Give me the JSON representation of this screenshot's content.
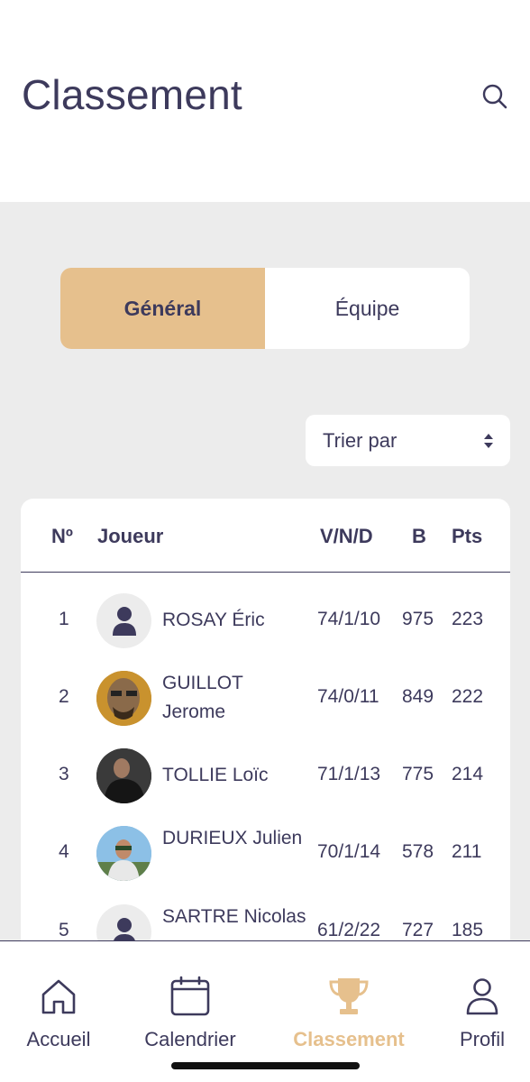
{
  "header": {
    "title": "Classement"
  },
  "segments": [
    {
      "label": "Général",
      "active": true
    },
    {
      "label": "Équipe",
      "active": false
    }
  ],
  "sort": {
    "label": "Trier par"
  },
  "table": {
    "columns": {
      "rank": "Nº",
      "player": "Joueur",
      "vnd": "V/N/D",
      "b": "B",
      "pts": "Pts"
    },
    "rows": [
      {
        "rank": "1",
        "name": "ROSAY Éric",
        "vnd": "74/1/10",
        "b": "975",
        "pts": "223",
        "avatar": "default-avatar-icon"
      },
      {
        "rank": "2",
        "name": "GUILLOT Jerome",
        "vnd": "74/0/11",
        "b": "849",
        "pts": "222",
        "avatar": "photo"
      },
      {
        "rank": "3",
        "name": "TOLLIE Loïc",
        "vnd": "71/1/13",
        "b": "775",
        "pts": "214",
        "avatar": "photo"
      },
      {
        "rank": "4",
        "name": "DURIEUX Julien",
        "vnd": "70/1/14",
        "b": "578",
        "pts": "211",
        "avatar": "photo"
      },
      {
        "rank": "5",
        "name": "SARTRE Nicolas",
        "vnd": "61/2/22",
        "b": "727",
        "pts": "185",
        "avatar": "default-avatar-icon"
      }
    ]
  },
  "tabbar": [
    {
      "label": "Accueil",
      "icon": "home-icon",
      "active": false
    },
    {
      "label": "Calendrier",
      "icon": "calendar-icon",
      "active": false
    },
    {
      "label": "Classement",
      "icon": "trophy-icon",
      "active": true
    },
    {
      "label": "Profil",
      "icon": "user-icon",
      "active": false
    }
  ],
  "colors": {
    "accent": "#e6c08d",
    "text": "#3d3a5c",
    "background": "#ececec",
    "card": "#ffffff"
  }
}
